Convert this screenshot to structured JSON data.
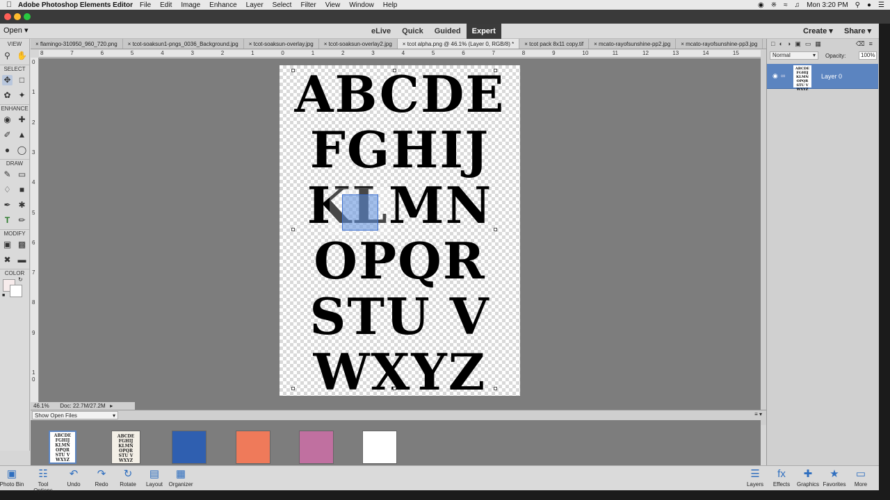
{
  "menubar": {
    "app": "Adobe Photoshop Elements Editor",
    "items": [
      "File",
      "Edit",
      "Image",
      "Enhance",
      "Layer",
      "Select",
      "Filter",
      "View",
      "Window",
      "Help"
    ],
    "clock": "Mon 3:20 PM"
  },
  "modebar": {
    "open_label": "Open",
    "modes": [
      "eLive",
      "Quick",
      "Guided",
      "Expert"
    ],
    "active_mode": "Expert",
    "create_label": "Create",
    "share_label": "Share"
  },
  "toolbox": {
    "sections": [
      "VIEW",
      "SELECT",
      "ENHANCE",
      "DRAW",
      "MODIFY",
      "COLOR"
    ]
  },
  "tabs": [
    "flamingo-310950_960_720.png",
    "tcot-soaksun1-pngs_0036_Background.jpg",
    "tcot-soaksun-overlay.jpg",
    "tcot-soaksun-overlay2.jpg",
    "tcot alpha.png @ 46.1% (Layer 0, RGB/8) *",
    "tcot pack 8x11 copy.tif",
    "mcato-rayofsunshine-pp2.jpg",
    "mcato-rayofsunshine-pp3.jpg"
  ],
  "active_tab": 4,
  "ruler_h": [
    "8",
    "7",
    "6",
    "5",
    "4",
    "3",
    "2",
    "1",
    "0",
    "1",
    "2",
    "3",
    "4",
    "5",
    "6",
    "7",
    "8",
    "9",
    "10",
    "11",
    "12",
    "13",
    "14",
    "15"
  ],
  "ruler_v": [
    "0",
    "1",
    "2",
    "3",
    "4",
    "5",
    "6",
    "7",
    "8",
    "9",
    "1",
    "0"
  ],
  "document": {
    "rows": [
      "ABCDE",
      "FGHIJ",
      "KLMN",
      "OPQR",
      "STU V",
      "WXYZ"
    ]
  },
  "status": {
    "zoom": "46.1%",
    "doc_size": "Doc: 22.7M/27.2M"
  },
  "photobin": {
    "dropdown": "Show Open Files",
    "thumb_colors": [
      "#ffffff",
      "#f3efe6",
      "#2f5fb0",
      "#ef7a5a",
      "#c070a0",
      "#ffffff"
    ]
  },
  "layers": {
    "blend_mode": "Normal",
    "opacity_label": "Opacity:",
    "opacity_value": "100%",
    "layer_name": "Layer 0",
    "thumb_text": "ABCDE FGHIJ KLMN OPQR STU V WXYZ"
  },
  "bottombar": {
    "left": [
      {
        "label": "Photo Bin",
        "icon": "photo-bin-icon"
      },
      {
        "label": "Tool Options",
        "icon": "tool-options-icon"
      },
      {
        "label": "Undo",
        "icon": "undo-icon"
      },
      {
        "label": "Redo",
        "icon": "redo-icon"
      },
      {
        "label": "Rotate",
        "icon": "rotate-icon"
      },
      {
        "label": "Layout",
        "icon": "layout-icon"
      },
      {
        "label": "Organizer",
        "icon": "organizer-icon"
      }
    ],
    "right": [
      {
        "label": "Layers",
        "icon": "layers-icon"
      },
      {
        "label": "Effects",
        "icon": "effects-icon"
      },
      {
        "label": "Graphics",
        "icon": "graphics-icon"
      },
      {
        "label": "Favorites",
        "icon": "favorites-icon"
      },
      {
        "label": "More",
        "icon": "more-icon"
      }
    ]
  },
  "colors": {
    "accent_blue": "#5b84c0",
    "mode_active_bg": "#3b3b3b",
    "canvas_gray": "#7d7d7d"
  }
}
